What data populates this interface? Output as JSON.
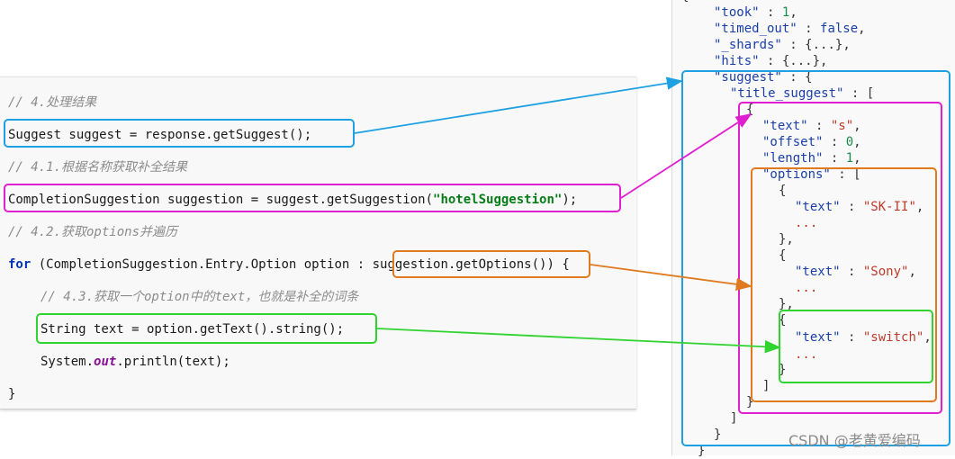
{
  "code": {
    "comment_process": "// 4.处理结果",
    "suggest_line": "Suggest suggest = response.getSuggest();",
    "comment_get_by_name": "// 4.1.根据名称获取补全结果",
    "suggestion_line_prefix": "CompletionSuggestion suggestion = suggest.getSuggestion(",
    "suggestion_line_string": "\"hotelSuggestion\"",
    "suggestion_line_suffix": ");",
    "comment_get_options": "// 4.2.获取options并遍历",
    "for_keyword": "for",
    "for_line_prefix": " (CompletionSuggestion.Entry.Option option : ",
    "for_line_options": "suggestion.getOptions()",
    "for_line_suffix": ") {",
    "comment_get_text": "// 4.3.获取一个option中的text，也就是补全的词条",
    "text_line": "String text = option.getText().string();",
    "print_prefix": "System.",
    "print_field": "out",
    "print_suffix": ".println(text);",
    "closing_brace": "}"
  },
  "json": {
    "open_brace": "{",
    "took_key": "\"took\"",
    "took_value": "1",
    "timed_out_key": "\"timed_out\"",
    "timed_out_value": "false",
    "shards_key": "\"_shards\"",
    "shards_value": "{...}",
    "hits_key": "\"hits\"",
    "hits_value": "{...}",
    "suggest_key": "\"suggest\"",
    "title_suggest_key": "\"title_suggest\"",
    "text_key": "\"text\"",
    "text_value": "\"s\"",
    "offset_key": "\"offset\"",
    "offset_value": "0",
    "length_key": "\"length\"",
    "length_value": "1",
    "options_key": "\"options\"",
    "option1_text": "\"SK-II\"",
    "option2_text": "\"Sony\"",
    "option3_text": "\"switch\"",
    "ellipsis": "...",
    "close_option_bracket": "]",
    "close_entry_brace": "}",
    "close_title_bracket": "]",
    "close_suggest_brace": "}",
    "close_root_brace": "}"
  },
  "colors": {
    "blue": "#1da1e2",
    "magenta": "#e020d0",
    "orange": "#e07a1e",
    "green": "#2fd42f"
  },
  "watermark": "CSDN @老黄爱编码"
}
